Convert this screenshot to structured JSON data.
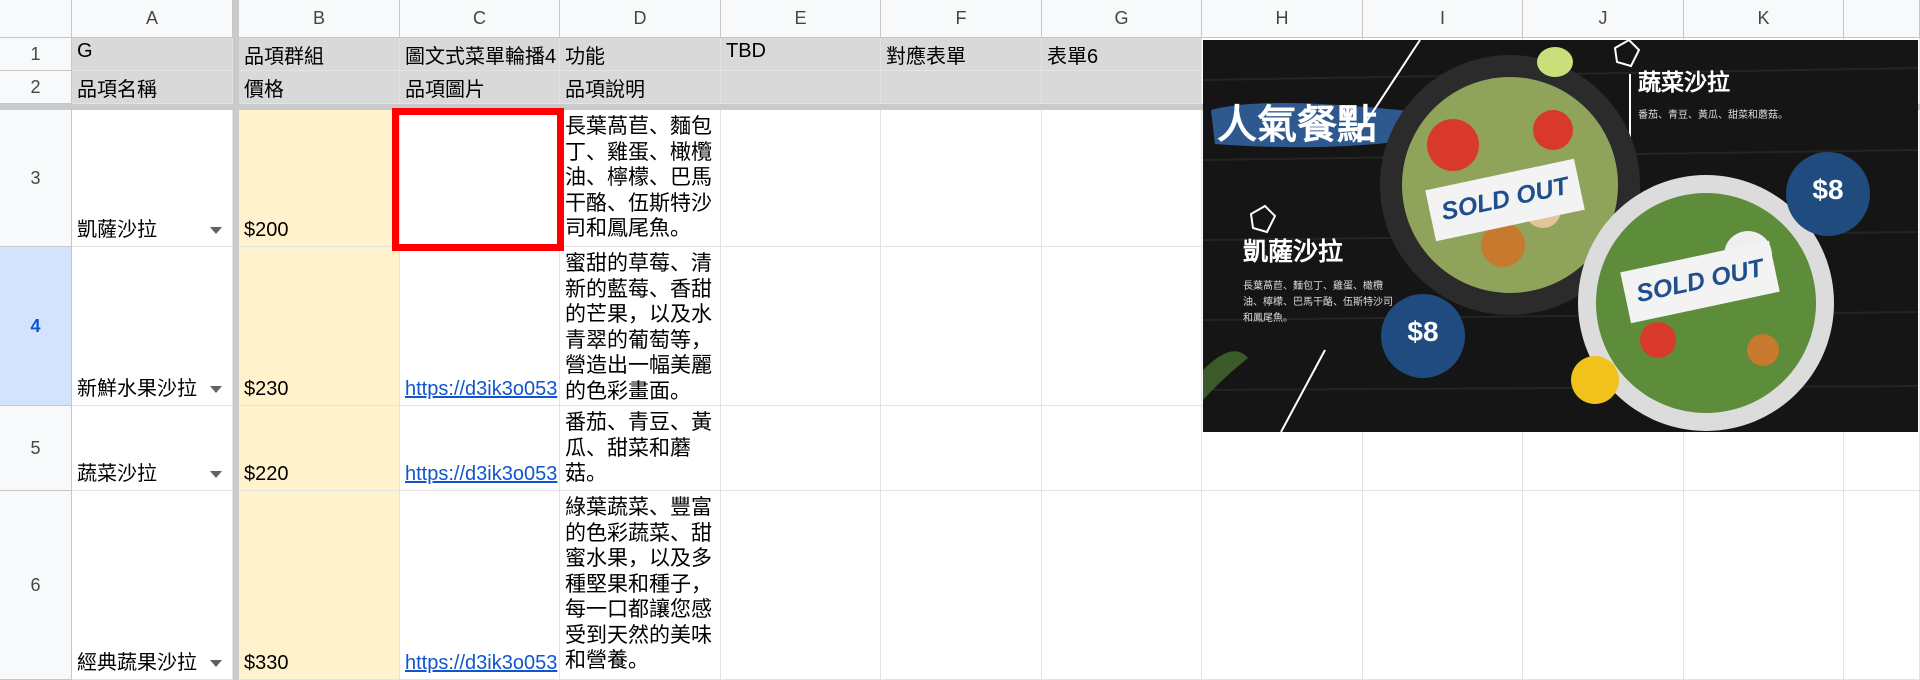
{
  "columns": [
    "A",
    "B",
    "C",
    "D",
    "E",
    "F",
    "G",
    "H",
    "I",
    "J",
    "K"
  ],
  "rows": [
    "1",
    "2",
    "3",
    "4",
    "5",
    "6"
  ],
  "header_row_1": {
    "a": "G",
    "b": "品項群組",
    "c": "圖文式菜單輪播4",
    "d": "功能",
    "e": "TBD",
    "f": "對應表單",
    "g": "表單6"
  },
  "header_row_2": {
    "a": "品項名稱",
    "b": "價格",
    "c": "品項圖片",
    "d": "品項說明"
  },
  "items": [
    {
      "name": "凱薩沙拉",
      "price": "$200",
      "image": "",
      "desc": "長葉萵苣、麵包丁、雞蛋、橄欖油、檸檬、巴馬干酪、伍斯特沙司和鳳尾魚。"
    },
    {
      "name": "新鮮水果沙拉",
      "price": "$230",
      "image": "https://d3ik3o053",
      "desc": "蜜甜的草莓、清新的藍莓、香甜的芒果，以及水青翠的葡萄等，營造出一幅美麗的色彩畫面。"
    },
    {
      "name": "蔬菜沙拉",
      "price": "$220",
      "image": "https://d3ik3o053",
      "desc": "番茄、青豆、黃瓜、甜菜和蘑菇。"
    },
    {
      "name": "經典蔬果沙拉",
      "price": "$330",
      "image": "https://d3ik3o053",
      "desc": "綠葉蔬菜、豐富的色彩蔬菜、甜蜜水果，以及多種堅果和種子，每一口都讓您感受到天然的美味和營養。"
    }
  ],
  "banner": {
    "title": "人氣餐點",
    "item1_name": "凱薩沙拉",
    "item1_desc1": "長葉萵苣、麵包丁、雞蛋、橄欖",
    "item1_desc2": "油、檸檬、巴馬干酪、伍斯特沙司",
    "item1_desc3": "和鳳尾魚。",
    "item2_name": "蔬菜沙拉",
    "item2_desc": "番茄、青豆、黃瓜、甜菜和蘑菇。",
    "price1": "$8",
    "price2": "$8",
    "sold_out": "SOLD OUT",
    "colors": {
      "bg": "#151515",
      "badge": "#1f4b7e",
      "brush": "#2f5d96",
      "sold_text": "#1f4f8c"
    }
  },
  "colors": {
    "header_gray": "#d9d9d9",
    "price_cream": "#fff2cc",
    "selected_row": "#d3e3fd",
    "link": "#1155cc",
    "highlight": "#ff0000"
  }
}
